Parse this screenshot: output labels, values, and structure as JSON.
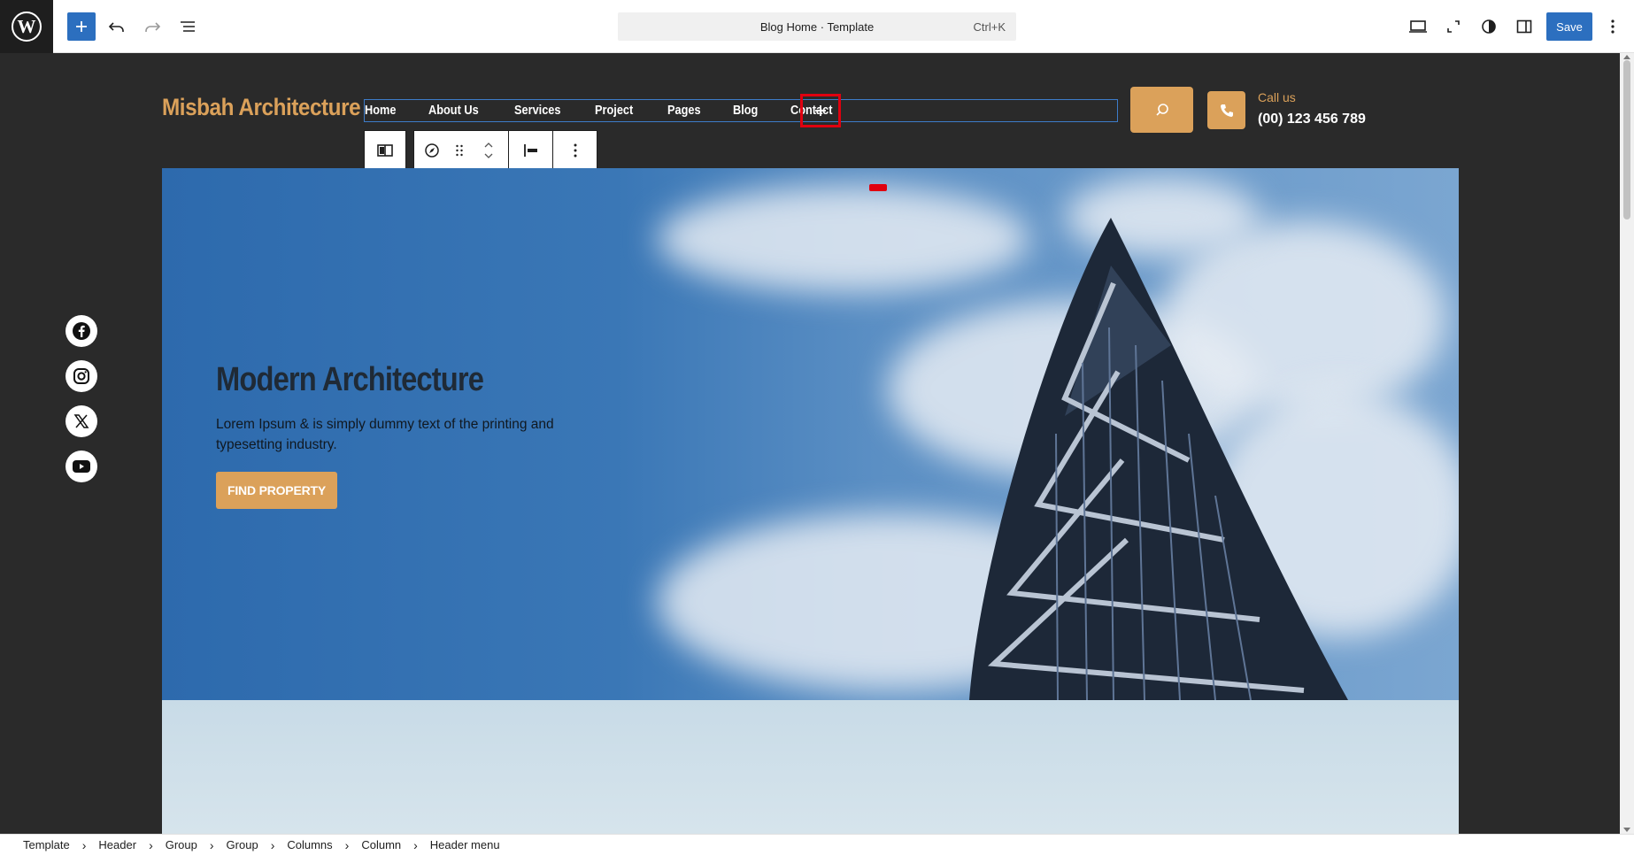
{
  "topbar": {
    "document_title": "Blog Home · Template",
    "shortcut": "Ctrl+K",
    "save_label": "Save"
  },
  "site": {
    "title": "Misbah Architecture",
    "nav": [
      "Home",
      "About Us",
      "Services",
      "Project",
      "Pages",
      "Blog",
      "Contact"
    ],
    "call_label": "Call us",
    "call_number": "(00) 123 456 789"
  },
  "hero": {
    "title": "Modern Architecture",
    "text": "Lorem Ipsum & is simply dummy text of the printing and typesetting industry.",
    "button": "FIND PROPERTY"
  },
  "social": [
    "facebook-icon",
    "instagram-icon",
    "x-icon",
    "youtube-icon"
  ],
  "breadcrumb": [
    "Template",
    "Header",
    "Group",
    "Group",
    "Columns",
    "Column",
    "Header menu"
  ],
  "colors": {
    "accent": "#dba15a",
    "wp_blue": "#2c6fbf",
    "canvas_bg": "#2a2a2a",
    "highlight_red": "#e0000f"
  }
}
